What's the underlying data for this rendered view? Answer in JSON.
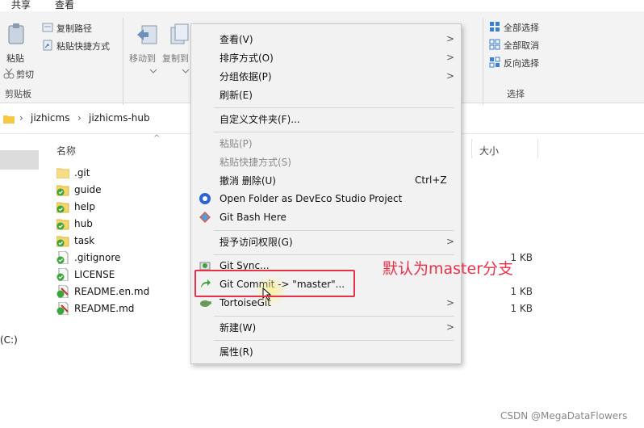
{
  "ribbon": {
    "tabs": [
      "共享",
      "查看"
    ],
    "clipboard": {
      "paste": "粘贴",
      "copy_path": "复制路径",
      "paste_shortcut": "粘贴快捷方式",
      "cut": "剪切",
      "group_label": "剪贴板"
    },
    "organize": {
      "move_to": "移动到",
      "copy_to": "复制到"
    },
    "select": {
      "select_all": "全部选择",
      "select_none": "全部取消",
      "invert": "反向选择",
      "group_label": "选择"
    }
  },
  "breadcrumb": [
    "jizhicms",
    "jizhicms-hub"
  ],
  "columns": {
    "name": "名称",
    "size": "大小"
  },
  "drive_label": "(C:)",
  "files": [
    {
      "name": ".git",
      "size": "",
      "icon": "folder-icon"
    },
    {
      "name": "guide",
      "size": "",
      "icon": "git-folder-icon"
    },
    {
      "name": "help",
      "size": "",
      "icon": "git-folder-icon"
    },
    {
      "name": "hub",
      "size": "",
      "icon": "git-folder-icon"
    },
    {
      "name": "task",
      "size": "",
      "icon": "git-folder-icon"
    },
    {
      "name": ".gitignore",
      "size": "1 KB",
      "icon": "git-file-icon"
    },
    {
      "name": "LICENSE",
      "size": "",
      "icon": "git-file-icon"
    },
    {
      "name": "README.en.md",
      "size": "1 KB",
      "icon": "git-file-modified-icon"
    },
    {
      "name": "README.md",
      "size": "1 KB",
      "icon": "git-file-modified-icon"
    }
  ],
  "context_menu": {
    "view": "查看(V)",
    "sort": "排序方式(O)",
    "group": "分组依据(P)",
    "refresh": "刷新(E)",
    "customize": "自定义文件夹(F)...",
    "paste": "粘贴(P)",
    "paste_shortcut": "粘贴快捷方式(S)",
    "undo": "撤消 删除(U)",
    "undo_shortcut": "Ctrl+Z",
    "open_deveco": "Open Folder as DevEco Studio Project",
    "git_bash": "Git Bash Here",
    "grant_access": "授予访问权限(G)",
    "git_sync": "Git Sync...",
    "git_commit": "Git Commit -> \"master\"...",
    "tortoise": "TortoiseGit",
    "new": "新建(W)",
    "properties": "属性(R)"
  },
  "annotation": "默认为master分支",
  "watermark": "CSDN @MegaDataFlowers",
  "colors": {
    "annotation_red": "#e8304a",
    "git_green": "#3aa53a",
    "folder_yellow": "#f5d46a"
  }
}
